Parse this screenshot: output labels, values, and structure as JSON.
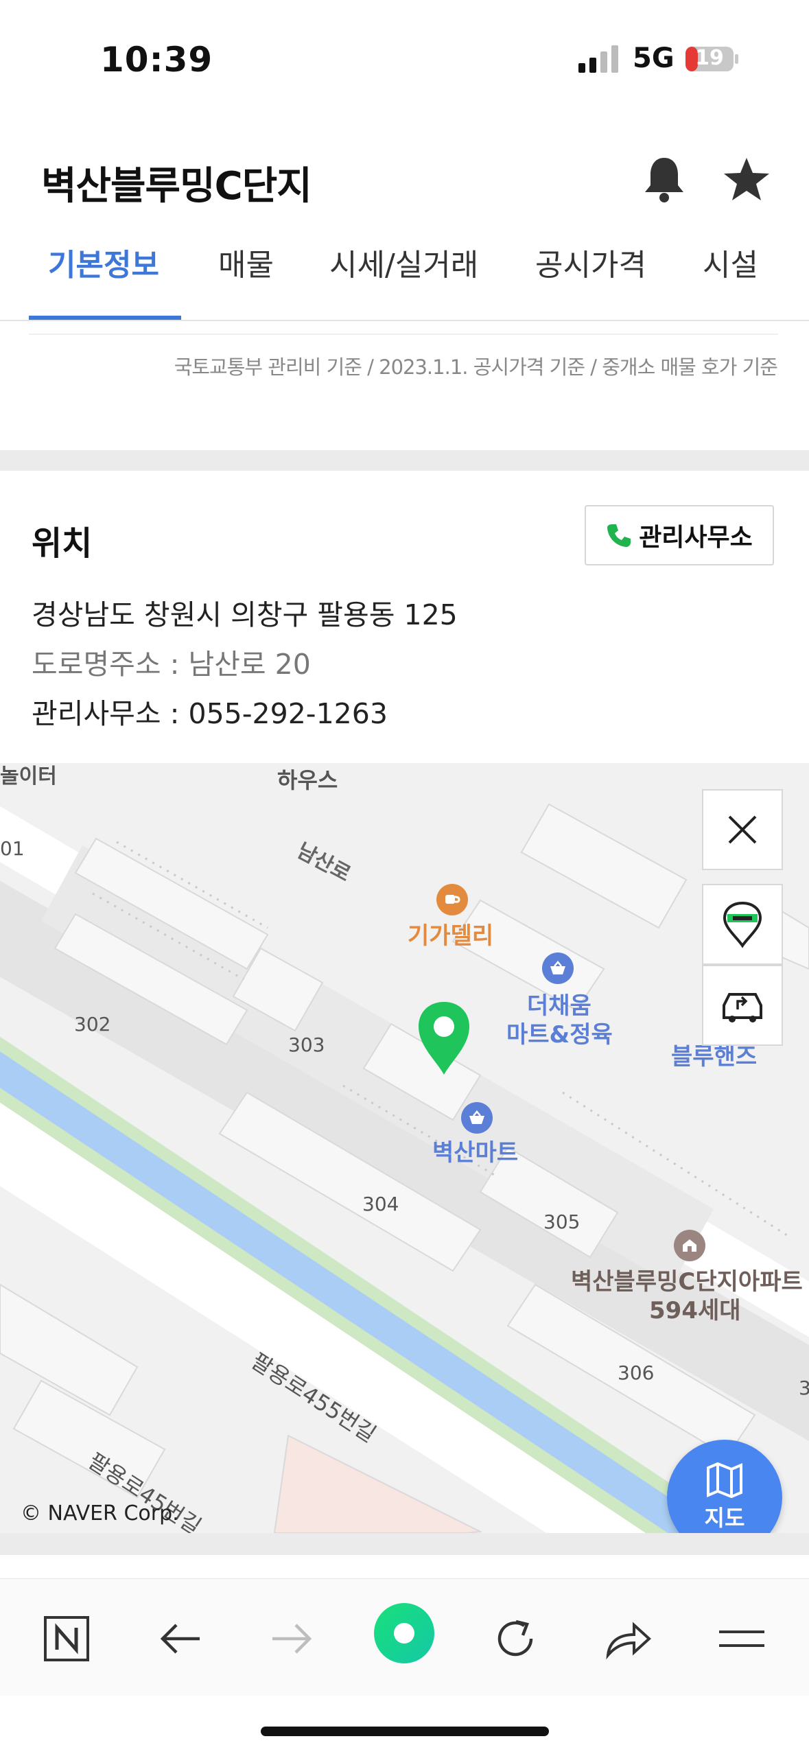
{
  "status_bar": {
    "time": "10:39",
    "network": "5G",
    "battery": "19"
  },
  "header": {
    "title": "벽산블루밍C단지"
  },
  "tabs": [
    {
      "label": "기본정보",
      "active": true
    },
    {
      "label": "매물",
      "active": false
    },
    {
      "label": "시세/실거래",
      "active": false
    },
    {
      "label": "공시가격",
      "active": false
    },
    {
      "label": "시설",
      "active": false
    }
  ],
  "basis_note": "국토교통부 관리비 기준 / 2023.1.1. 공시가격 기준 / 중개소 매물 호가 기준",
  "location": {
    "title": "위치",
    "office_button": "관리사무소",
    "address": "경상남도 창원시 의창구 팔용동 125",
    "road_address": "도로명주소 : 남산로 20",
    "office_phone": "관리사무소 : 055-292-1263"
  },
  "map": {
    "labels": {
      "playground": "놀이터",
      "house": "하우스",
      "road_namsan": "남산로",
      "cafe": "기가델리",
      "mart1_line1": "더채움",
      "mart1_line2": "마트&정육",
      "blue_hands": "블루핸즈",
      "mart2": "벽산마트",
      "complex_line1": "벽산블루밍C단지아파트",
      "complex_line2": "594세대",
      "road_palyong1": "팔용로455번길",
      "road_palyong2": "팔용로45번길"
    },
    "building_numbers": [
      "01",
      "302",
      "303",
      "304",
      "305",
      "306",
      "3"
    ],
    "fab_label": "지도",
    "copyright": "© NAVER Corp."
  },
  "colors": {
    "accent": "#3d77d8",
    "marker": "#1fc45a",
    "fab": "#4a86f0",
    "cafe": "#e48a3f",
    "poi": "#5b7fd6"
  }
}
